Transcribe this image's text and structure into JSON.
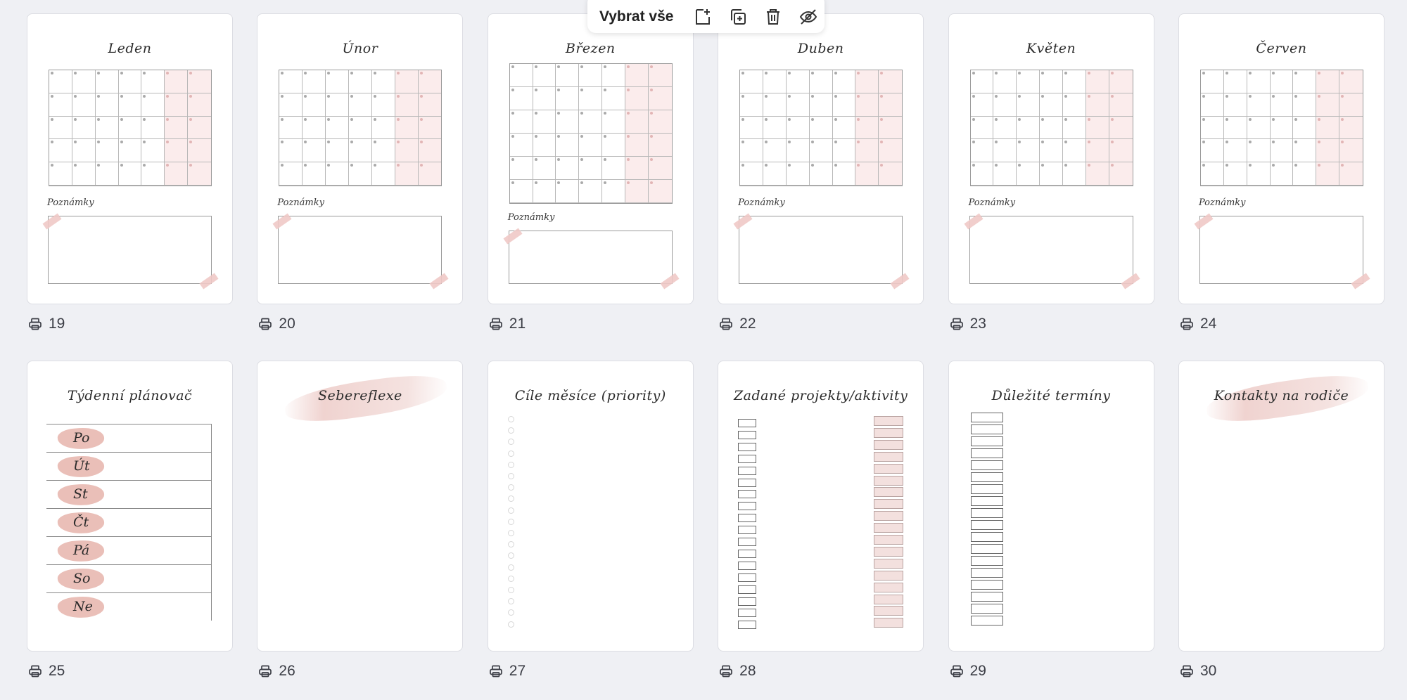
{
  "toolbar": {
    "select_all_label": "Vybrat vše",
    "icons": [
      "add-page-icon",
      "duplicate-icon",
      "trash-icon",
      "hide-icon"
    ]
  },
  "pages": [
    {
      "number": "19",
      "title": "Leden",
      "type": "calendar",
      "notes_label": "Poznámky"
    },
    {
      "number": "20",
      "title": "Únor",
      "type": "calendar",
      "notes_label": "Poznámky"
    },
    {
      "number": "21",
      "title": "Březen",
      "type": "calendar6",
      "notes_label": "Poznámky"
    },
    {
      "number": "22",
      "title": "Duben",
      "type": "calendar",
      "notes_label": "Poznámky"
    },
    {
      "number": "23",
      "title": "Květen",
      "type": "calendar",
      "notes_label": "Poznámky"
    },
    {
      "number": "24",
      "title": "Červen",
      "type": "calendar",
      "notes_label": "Poznámky"
    },
    {
      "number": "25",
      "title": "Týdenní plánovač",
      "type": "weekly",
      "days": [
        "Po",
        "Út",
        "St",
        "Čt",
        "Pá",
        "So",
        "Ne"
      ]
    },
    {
      "number": "26",
      "title": "Sebereflexe",
      "type": "lines-brush"
    },
    {
      "number": "27",
      "title": "Cíle měsíce (priority)",
      "type": "goals"
    },
    {
      "number": "28",
      "title": "Zadané projekty/aktivity",
      "type": "projects"
    },
    {
      "number": "29",
      "title": "Důležité termíny",
      "type": "dates"
    },
    {
      "number": "30",
      "title": "Kontakty na rodiče",
      "type": "lines-brush"
    }
  ],
  "colors": {
    "background": "#eff0f4",
    "accent_pink": "#eabfb8",
    "weekend_fill": "#fbecec"
  }
}
